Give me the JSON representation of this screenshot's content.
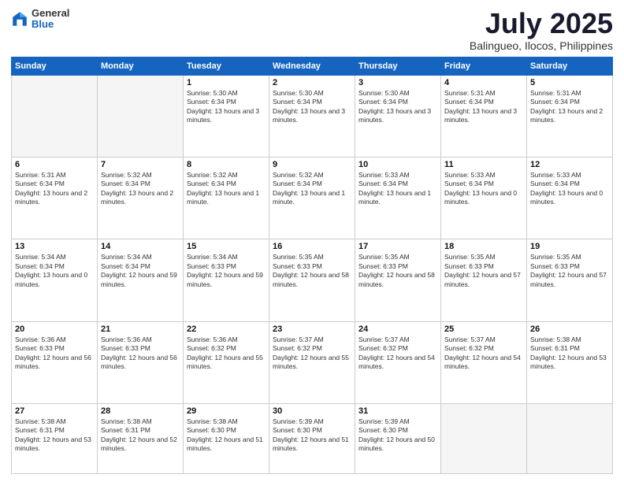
{
  "logo": {
    "general": "General",
    "blue": "Blue"
  },
  "header": {
    "month": "July 2025",
    "location": "Balingueo, Ilocos, Philippines"
  },
  "weekdays": [
    "Sunday",
    "Monday",
    "Tuesday",
    "Wednesday",
    "Thursday",
    "Friday",
    "Saturday"
  ],
  "weeks": [
    [
      {
        "day": "",
        "empty": true
      },
      {
        "day": "",
        "empty": true
      },
      {
        "day": "1",
        "sunrise": "5:30 AM",
        "sunset": "6:34 PM",
        "daylight": "13 hours and 3 minutes."
      },
      {
        "day": "2",
        "sunrise": "5:30 AM",
        "sunset": "6:34 PM",
        "daylight": "13 hours and 3 minutes."
      },
      {
        "day": "3",
        "sunrise": "5:30 AM",
        "sunset": "6:34 PM",
        "daylight": "13 hours and 3 minutes."
      },
      {
        "day": "4",
        "sunrise": "5:31 AM",
        "sunset": "6:34 PM",
        "daylight": "13 hours and 3 minutes."
      },
      {
        "day": "5",
        "sunrise": "5:31 AM",
        "sunset": "6:34 PM",
        "daylight": "13 hours and 2 minutes."
      }
    ],
    [
      {
        "day": "6",
        "sunrise": "5:31 AM",
        "sunset": "6:34 PM",
        "daylight": "13 hours and 2 minutes."
      },
      {
        "day": "7",
        "sunrise": "5:32 AM",
        "sunset": "6:34 PM",
        "daylight": "13 hours and 2 minutes."
      },
      {
        "day": "8",
        "sunrise": "5:32 AM",
        "sunset": "6:34 PM",
        "daylight": "13 hours and 1 minute."
      },
      {
        "day": "9",
        "sunrise": "5:32 AM",
        "sunset": "6:34 PM",
        "daylight": "13 hours and 1 minute."
      },
      {
        "day": "10",
        "sunrise": "5:33 AM",
        "sunset": "6:34 PM",
        "daylight": "13 hours and 1 minute."
      },
      {
        "day": "11",
        "sunrise": "5:33 AM",
        "sunset": "6:34 PM",
        "daylight": "13 hours and 0 minutes."
      },
      {
        "day": "12",
        "sunrise": "5:33 AM",
        "sunset": "6:34 PM",
        "daylight": "13 hours and 0 minutes."
      }
    ],
    [
      {
        "day": "13",
        "sunrise": "5:34 AM",
        "sunset": "6:34 PM",
        "daylight": "13 hours and 0 minutes."
      },
      {
        "day": "14",
        "sunrise": "5:34 AM",
        "sunset": "6:34 PM",
        "daylight": "12 hours and 59 minutes."
      },
      {
        "day": "15",
        "sunrise": "5:34 AM",
        "sunset": "6:33 PM",
        "daylight": "12 hours and 59 minutes."
      },
      {
        "day": "16",
        "sunrise": "5:35 AM",
        "sunset": "6:33 PM",
        "daylight": "12 hours and 58 minutes."
      },
      {
        "day": "17",
        "sunrise": "5:35 AM",
        "sunset": "6:33 PM",
        "daylight": "12 hours and 58 minutes."
      },
      {
        "day": "18",
        "sunrise": "5:35 AM",
        "sunset": "6:33 PM",
        "daylight": "12 hours and 57 minutes."
      },
      {
        "day": "19",
        "sunrise": "5:35 AM",
        "sunset": "6:33 PM",
        "daylight": "12 hours and 57 minutes."
      }
    ],
    [
      {
        "day": "20",
        "sunrise": "5:36 AM",
        "sunset": "6:33 PM",
        "daylight": "12 hours and 56 minutes."
      },
      {
        "day": "21",
        "sunrise": "5:36 AM",
        "sunset": "6:33 PM",
        "daylight": "12 hours and 56 minutes."
      },
      {
        "day": "22",
        "sunrise": "5:36 AM",
        "sunset": "6:32 PM",
        "daylight": "12 hours and 55 minutes."
      },
      {
        "day": "23",
        "sunrise": "5:37 AM",
        "sunset": "6:32 PM",
        "daylight": "12 hours and 55 minutes."
      },
      {
        "day": "24",
        "sunrise": "5:37 AM",
        "sunset": "6:32 PM",
        "daylight": "12 hours and 54 minutes."
      },
      {
        "day": "25",
        "sunrise": "5:37 AM",
        "sunset": "6:32 PM",
        "daylight": "12 hours and 54 minutes."
      },
      {
        "day": "26",
        "sunrise": "5:38 AM",
        "sunset": "6:31 PM",
        "daylight": "12 hours and 53 minutes."
      }
    ],
    [
      {
        "day": "27",
        "sunrise": "5:38 AM",
        "sunset": "6:31 PM",
        "daylight": "12 hours and 53 minutes."
      },
      {
        "day": "28",
        "sunrise": "5:38 AM",
        "sunset": "6:31 PM",
        "daylight": "12 hours and 52 minutes."
      },
      {
        "day": "29",
        "sunrise": "5:38 AM",
        "sunset": "6:30 PM",
        "daylight": "12 hours and 51 minutes."
      },
      {
        "day": "30",
        "sunrise": "5:39 AM",
        "sunset": "6:30 PM",
        "daylight": "12 hours and 51 minutes."
      },
      {
        "day": "31",
        "sunrise": "5:39 AM",
        "sunset": "6:30 PM",
        "daylight": "12 hours and 50 minutes."
      },
      {
        "day": "",
        "empty": true
      },
      {
        "day": "",
        "empty": true
      }
    ]
  ]
}
